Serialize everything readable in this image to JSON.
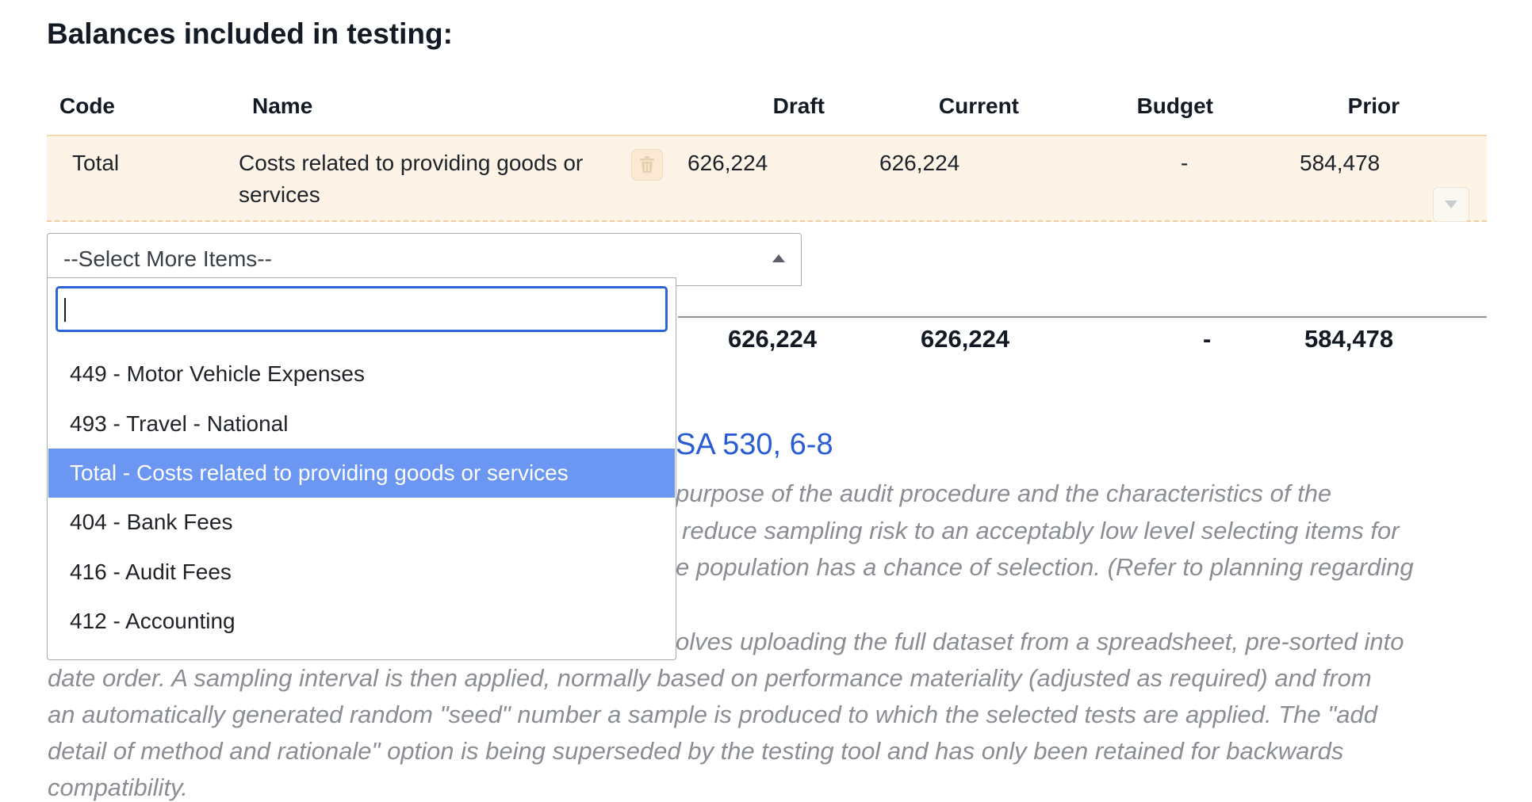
{
  "section_title": "Balances included in testing:",
  "table": {
    "headers": {
      "code": "Code",
      "name": "Name",
      "draft": "Draft",
      "current": "Current",
      "budget": "Budget",
      "prior": "Prior"
    },
    "row": {
      "code": "Total",
      "name": "Costs related to providing goods or services",
      "draft": "626,224",
      "current": "626,224",
      "budget": "-",
      "prior": "584,478"
    },
    "totals": {
      "draft": "626,224",
      "current": "626,224",
      "budget": "-",
      "prior": "584,478"
    }
  },
  "select": {
    "placeholder": "--Select More Items--",
    "search_value": "",
    "options": [
      {
        "label": "449 - Motor Vehicle Expenses",
        "selected": false
      },
      {
        "label": "493 - Travel - National",
        "selected": false
      },
      {
        "label": "Total - Costs related to providing goods or services",
        "selected": true
      },
      {
        "label": "404 - Bank Fees",
        "selected": false
      },
      {
        "label": "416 - Audit Fees",
        "selected": false
      },
      {
        "label": "412 - Accounting",
        "selected": false
      }
    ]
  },
  "background": {
    "reference": "SA 530, 6-8",
    "lines": [
      "purpose of the audit procedure and the characteristics of the",
      "reduce sampling risk to an acceptably low level selecting items for",
      "e population has a chance of selection. (Refer to planning regarding",
      "olves uploading the full dataset from a spreadsheet, pre-sorted into",
      "date order. A sampling interval is then applied, normally based on performance materiality (adjusted as required) and from",
      "an automatically generated random \"seed\" number a sample is produced to which the selected tests are applied. The \"add",
      "detail of method and rationale\" option is being superseded by the testing tool and has only been retained for backwards",
      "compatibility."
    ]
  },
  "colors": {
    "row_bg": "#fdf3e7",
    "accent": "#2c63d6",
    "selected_option": "#6b97f2",
    "muted_text": "#8a8e94"
  },
  "icons": {
    "delete": "trash-icon",
    "expand": "chevron-down-icon",
    "select_toggle": "caret-up-icon"
  }
}
